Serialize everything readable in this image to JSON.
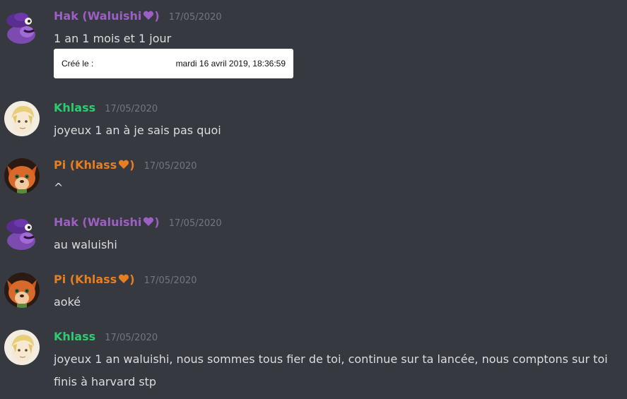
{
  "messages": [
    {
      "author": "Hak (Waluishi",
      "author_close": ")",
      "heart_color": "#9c5fc4",
      "timestamp": "17/05/2020",
      "text": "1 an 1 mois et 1 jour",
      "attachment": {
        "label": "Créé le :",
        "value": "mardi 16 avril 2019, 18:36:59"
      }
    },
    {
      "author": "Khlass",
      "timestamp": "17/05/2020",
      "text": "joyeux 1 an à je sais pas quoi"
    },
    {
      "author": "Pi (Khlass",
      "author_close": ")",
      "heart_color": "#e67e22",
      "timestamp": "17/05/2020",
      "text": "^"
    },
    {
      "author": "Hak (Waluishi",
      "author_close": ")",
      "heart_color": "#9c5fc4",
      "timestamp": "17/05/2020",
      "text": "au waluishi"
    },
    {
      "author": "Pi (Khlass",
      "author_close": ")",
      "heart_color": "#e67e22",
      "timestamp": "17/05/2020",
      "text": "aoké"
    },
    {
      "author": "Khlass",
      "timestamp": "17/05/2020",
      "text": "joyeux 1 an waluishi, nous sommes tous fier de toi, continue sur ta lancée, nous comptons sur toi finis à harvard stp"
    }
  ],
  "colors": {
    "background": "#36393f",
    "hak": "#9c5fc4",
    "khlass": "#2ecc71",
    "pi": "#e67e22",
    "timestamp": "#72767d",
    "text": "#dcddde"
  }
}
